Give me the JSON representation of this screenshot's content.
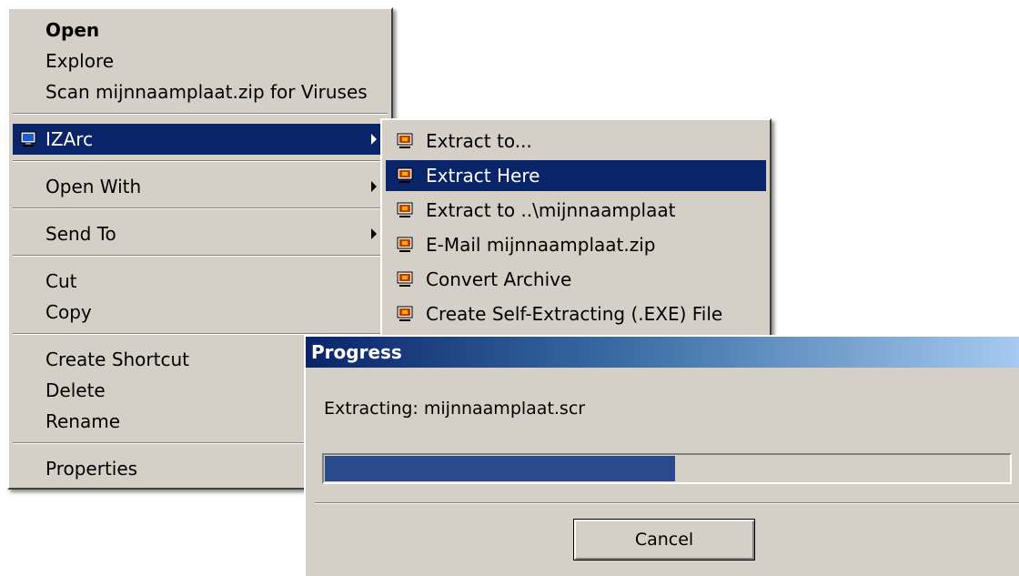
{
  "context_menu": {
    "items": [
      {
        "label": "Open"
      },
      {
        "label": "Explore"
      },
      {
        "label": "Scan mijnnaamplaat.zip for Viruses"
      },
      {
        "label": "IZArc",
        "icon": "izarc-icon"
      },
      {
        "label": "Open With"
      },
      {
        "label": "Send To"
      },
      {
        "label": "Cut"
      },
      {
        "label": "Copy"
      },
      {
        "label": "Create Shortcut"
      },
      {
        "label": "Delete"
      },
      {
        "label": "Rename"
      },
      {
        "label": "Properties"
      }
    ]
  },
  "izarc_submenu": {
    "items": [
      {
        "label": "Extract to...",
        "icon": "izarc-icon"
      },
      {
        "label": "Extract Here",
        "icon": "izarc-icon"
      },
      {
        "label": "Extract to ..\\mijnnaamplaat",
        "icon": "izarc-icon"
      },
      {
        "label": "E-Mail mijnnaamplaat.zip",
        "icon": "izarc-icon"
      },
      {
        "label": "Convert Archive",
        "icon": "izarc-icon"
      },
      {
        "label": "Create Self-Extracting (.EXE) File",
        "icon": "izarc-icon"
      }
    ]
  },
  "progress_dialog": {
    "title": "Progress",
    "status": "Extracting: mijnnaamplaat.scr",
    "progress_fraction": 0.51,
    "cancel_label": "Cancel"
  },
  "colors": {
    "menu_background": "#d4d0c8",
    "highlight": "#0a246a",
    "progress_fill": "#2b4a8e"
  }
}
